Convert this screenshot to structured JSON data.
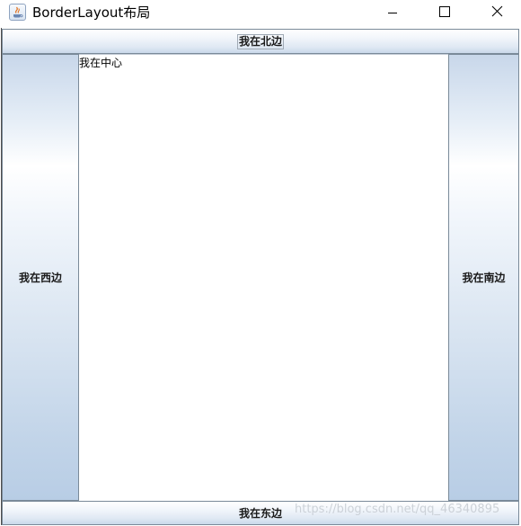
{
  "window": {
    "title": "BorderLayout布局",
    "icon": "java-coffee-icon",
    "controls": {
      "minimize_icon": "minimize-icon",
      "maximize_icon": "maximize-icon",
      "close_icon": "close-icon"
    }
  },
  "layout": {
    "north_button": "我在北边",
    "west_button": "我在西边",
    "center_text": "我在中心",
    "east_button": "我在南边",
    "south_button": "我在东边"
  },
  "watermark": "https://blog.csdn.net/qq_46340895",
  "colors": {
    "button_gradient_light": "#ffffff",
    "button_gradient_dark": "#b8cde5",
    "button_border": "#7a8a99",
    "center_background": "#ffffff"
  }
}
